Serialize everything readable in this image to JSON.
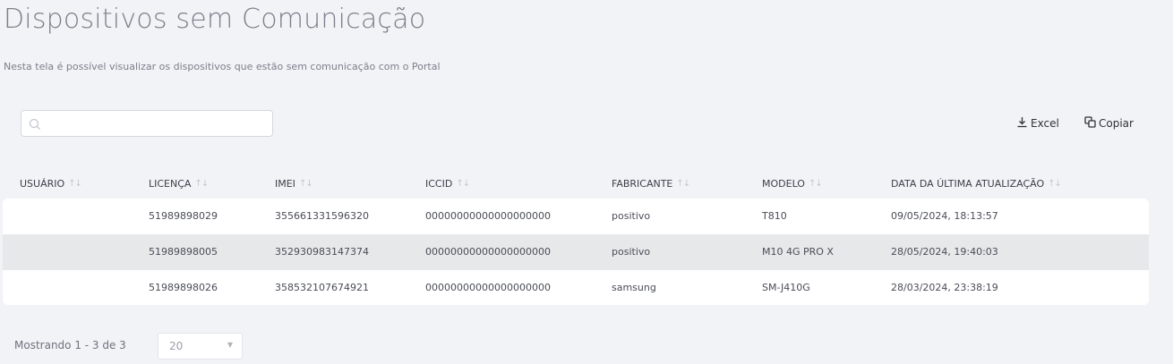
{
  "header": {
    "title": "Dispositivos sem Comunicação",
    "subtitle": "Nesta tela é possível visualizar os dispositivos que estão sem comunicação com o Portal"
  },
  "search": {
    "placeholder": "",
    "value": ""
  },
  "toolbar": {
    "excel_label": "Excel",
    "copy_label": "Copiar"
  },
  "table": {
    "columns": [
      "USUÁRIO",
      "LICENÇA",
      "IMEI",
      "ICCID",
      "FABRICANTE",
      "MODELO",
      "DATA DA ÚLTIMA ATUALIZAÇÃO"
    ],
    "rows": [
      [
        "",
        "51989898029",
        "355661331596320",
        "00000000000000000000",
        "positivo",
        "T810",
        "09/05/2024, 18:13:57"
      ],
      [
        "",
        "51989898005",
        "352930983147374",
        "00000000000000000000",
        "positivo",
        "M10 4G PRO X",
        "28/05/2024, 19:40:03"
      ],
      [
        "",
        "51989898026",
        "358532107674921",
        "00000000000000000000",
        "samsung",
        "SM-J410G",
        "28/03/2024, 23:38:19"
      ]
    ]
  },
  "footer": {
    "showing": "Mostrando 1 - 3 de 3",
    "page_size": "20"
  },
  "icons": {
    "search": "search-icon",
    "excel": "download-icon",
    "copy": "copy-icon",
    "sort": "sort-icon",
    "dropdown": "chevron-down-icon"
  }
}
